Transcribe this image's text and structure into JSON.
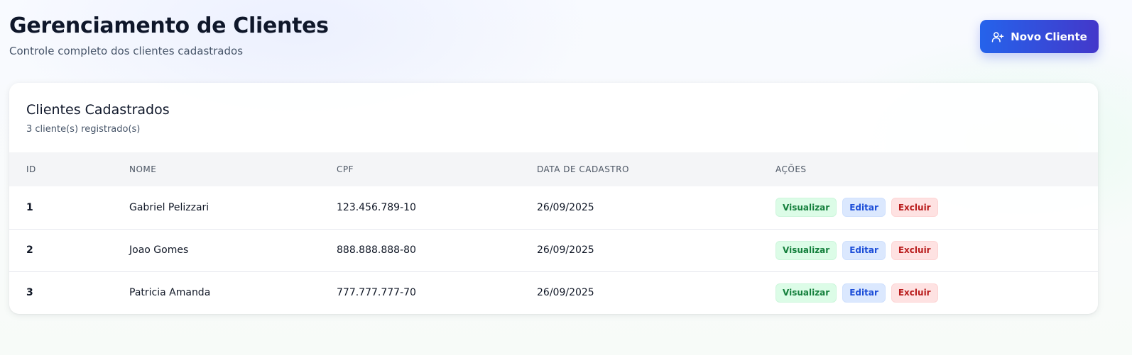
{
  "header": {
    "title": "Gerenciamento de Clientes",
    "subtitle": "Controle completo dos clientes cadastrados",
    "new_button_label": "Novo Cliente",
    "new_button_icon": "user-plus-icon"
  },
  "card": {
    "title": "Clientes Cadastrados",
    "count": "3 cliente(s) registrado(s)"
  },
  "table": {
    "columns": [
      "ID",
      "NOME",
      "CPF",
      "DATA DE CADASTRO",
      "AÇÕES"
    ],
    "rows": [
      {
        "id": "1",
        "name": "Gabriel Pelizzari",
        "cpf": "123.456.789-10",
        "date": "26/09/2025"
      },
      {
        "id": "2",
        "name": "Joao Gomes",
        "cpf": "888.888.888-80",
        "date": "26/09/2025"
      },
      {
        "id": "3",
        "name": "Patricia Amanda",
        "cpf": "777.777.777-70",
        "date": "26/09/2025"
      }
    ],
    "actions": {
      "view": "Visualizar",
      "edit": "Editar",
      "delete": "Excluir"
    }
  },
  "colors": {
    "button_gradient_start": "#2563eb",
    "button_gradient_end": "#4338ca",
    "view_bg": "#dcfce7",
    "view_text": "#15803d",
    "edit_bg": "#dbe8fe",
    "edit_text": "#1d4ed8",
    "delete_bg": "#fee2e2",
    "delete_text": "#b91c1c"
  }
}
